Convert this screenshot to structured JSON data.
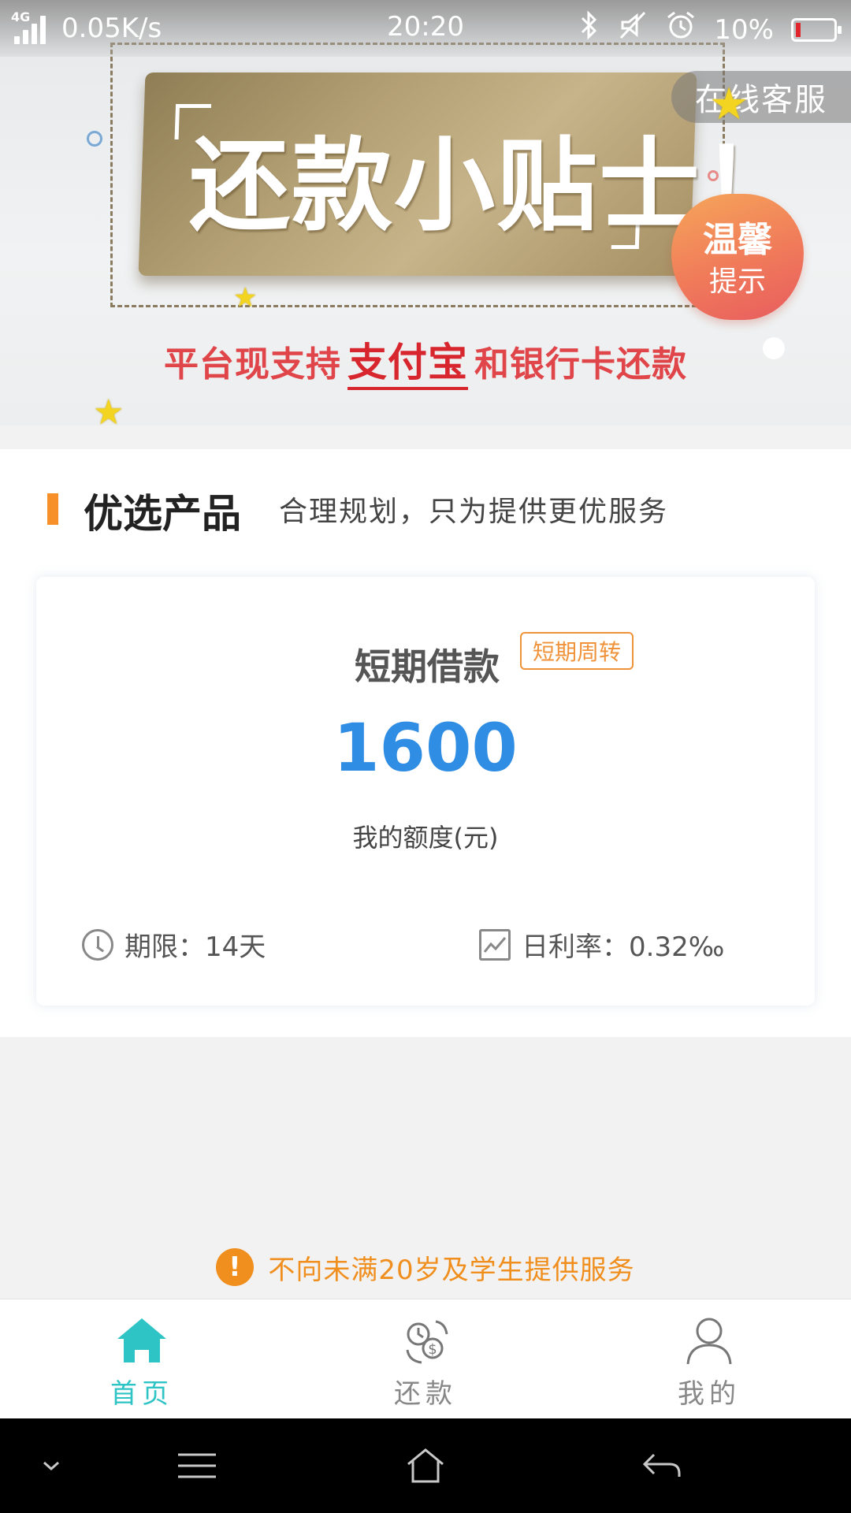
{
  "status_bar": {
    "network": "4G",
    "speed": "0.05K/s",
    "time": "20:20",
    "battery": "10%",
    "battery_level": 0.1,
    "icons": [
      "signal-icon",
      "bluetooth-icon",
      "mute-icon",
      "alarm-icon",
      "battery-icon"
    ]
  },
  "banner": {
    "headline": "还款小贴士！",
    "service_button": "在线客服",
    "heart_line1": "温馨",
    "heart_line2": "提示",
    "subline_prefix": "平台现支持",
    "subline_highlight": "支付宝",
    "subline_suffix": "和银行卡还款"
  },
  "section": {
    "title": "优选产品",
    "subtitle": "合理规划，只为提供更优服务"
  },
  "product": {
    "name": "短期借款",
    "tag": "短期周转",
    "amount": "1600",
    "amount_label": "我的额度(元)",
    "term": "期限：14天",
    "rate": "日利率：0.32‰"
  },
  "notice": {
    "icon": "!",
    "text": "不向未满20岁及学生提供服务"
  },
  "tabs": [
    {
      "label": "首页",
      "icon": "home-icon",
      "active": true
    },
    {
      "label": "还款",
      "icon": "repay-icon",
      "active": false
    },
    {
      "label": "我的",
      "icon": "profile-icon",
      "active": false
    }
  ],
  "colors": {
    "accent": "#f79028",
    "amount": "#2f8de4",
    "active_tab": "#2ec4c6",
    "notice": "#f08f1e"
  }
}
